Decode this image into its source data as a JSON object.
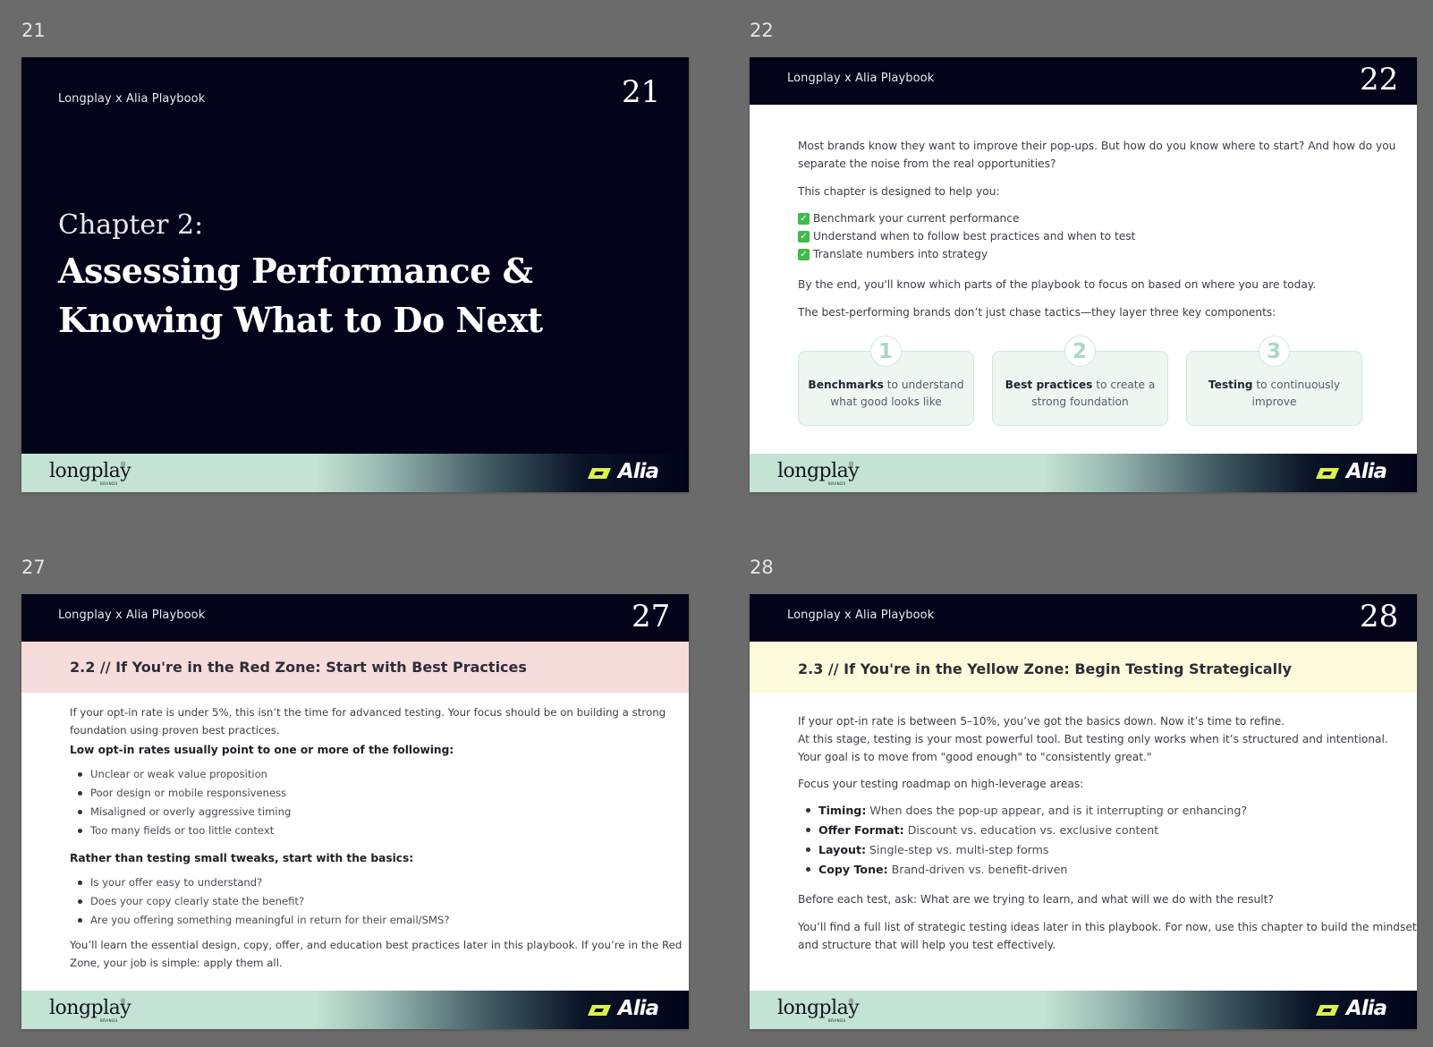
{
  "pages": [
    {
      "label": "21",
      "brand": "Longplay x Alia Playbook",
      "slide_number": "21",
      "chapter_kicker": "Chapter 2:",
      "title_line1": "Assessing Performance &",
      "title_line2": "Knowing What to Do Next"
    },
    {
      "label": "22",
      "brand": "Longplay x Alia Playbook",
      "slide_number": "22",
      "intro_line1": "Most brands know they want to improve their pop-ups. But how do you know where to start? And how do you",
      "intro_line2": "separate the noise from the real opportunities?",
      "designed": "This chapter is designed to help you:",
      "checklist": [
        "Benchmark your current performance",
        "Understand when to follow best practices and when to test",
        "Translate numbers into strategy"
      ],
      "by_end": "By the end, you'll know which parts of the playbook to focus on based on where you are today.",
      "best_brands": "The best-performing brands don’t just chase tactics—they layer three key components:",
      "cards": [
        {
          "num": "1",
          "bold": "Benchmarks",
          "rest": " to understand",
          "line2": "what good looks like"
        },
        {
          "num": "2",
          "bold": "Best practices",
          "rest": " to create a",
          "line2": "strong foundation"
        },
        {
          "num": "3",
          "bold": "Testing",
          "rest": " to continuously",
          "line2": "improve"
        }
      ]
    },
    {
      "label": "27",
      "brand": "Longplay x Alia Playbook",
      "slide_number": "27",
      "heading": "2.2 // If You're in the Red Zone: Start with Best Practices",
      "para1_line1": "If your opt-in rate is under 5%, this isn’t the time for advanced testing. Your focus should be on building a strong",
      "para1_line2": "foundation using proven best practices.",
      "subhead1": "Low opt-in rates usually point to one or more of the following:",
      "list1": [
        "Unclear or weak value proposition",
        "Poor design or mobile responsiveness",
        "Misaligned or overly aggressive timing",
        "Too many fields or too little context"
      ],
      "subhead2": "Rather than testing small tweaks, start with the basics:",
      "list2": [
        "Is your offer easy to understand?",
        "Does your copy clearly state the benefit?",
        "Are you offering something meaningful in return for their email/SMS?"
      ],
      "closing_line1": "You’ll learn the essential design, copy, offer, and education best practices later in this playbook. If you’re in the Red",
      "closing_line2": "Zone, your job is simple: apply them all."
    },
    {
      "label": "28",
      "brand": "Longplay x Alia Playbook",
      "slide_number": "28",
      "heading": "2.3 // If You're in the Yellow Zone: Begin Testing Strategically",
      "intro_line1": "If your opt-in rate is between 5–10%, you’ve got the basics down. Now it’s time to refine.",
      "intro_line2": "At this stage, testing is your most powerful tool. But testing only works when it’s structured and intentional.",
      "intro_line3": "Your goal is to move from \"good enough\" to \"consistently great.\"",
      "focus": "Focus your testing roadmap on high-leverage areas:",
      "areas": [
        {
          "term": "Timing:",
          "desc": "When does the pop-up appear, and is it interrupting or enhancing?"
        },
        {
          "term": "Offer Format:",
          "desc": "Discount vs. education vs. exclusive content"
        },
        {
          "term": "Layout:",
          "desc": "Single-step vs. multi-step forms"
        },
        {
          "term": "Copy Tone:",
          "desc": "Brand-driven vs. benefit-driven"
        }
      ],
      "ask": "Before each test, ask: What are we trying to learn, and what will we do with the result?",
      "closing_line1": "You’ll find a full list of strategic testing ideas later in this playbook. For now, use this chapter to build the mindset",
      "closing_line2": "and structure that will help you test effectively."
    }
  ],
  "footer": {
    "longplay": "longplay",
    "longplay_sub": "BRANDS",
    "longplay_tm": "®",
    "alia": "Alia"
  },
  "colors": {
    "navy": "#03031a",
    "mint": "#c3e3d4",
    "red_zone": "#f7dcdc",
    "yellow_zone": "#fefbdc",
    "alia_mark": "#d8f24a",
    "check": "#3dbb4b"
  }
}
